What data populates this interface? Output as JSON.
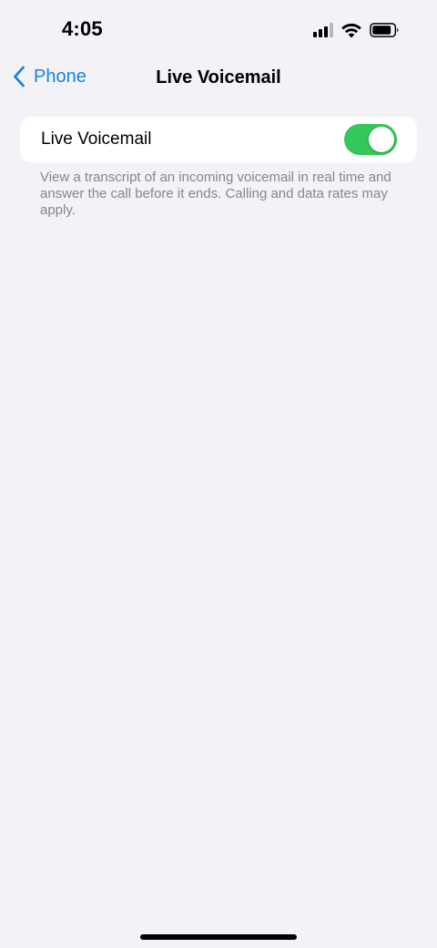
{
  "status_bar": {
    "time": "4:05",
    "icons": [
      "cellular-signal-icon",
      "wifi-icon",
      "battery-icon"
    ]
  },
  "nav": {
    "back_label": "Phone",
    "title": "Live Voicemail"
  },
  "settings": {
    "live_voicemail": {
      "label": "Live Voicemail",
      "enabled": true
    },
    "footer": "View a transcript of an incoming voicemail in real time and answer the call before it ends. Calling and data rates may apply."
  },
  "colors": {
    "accent": "#1a82e0",
    "toggle_on": "#34c759",
    "background": "#f2f2f7",
    "footer_text": "#86868b"
  }
}
